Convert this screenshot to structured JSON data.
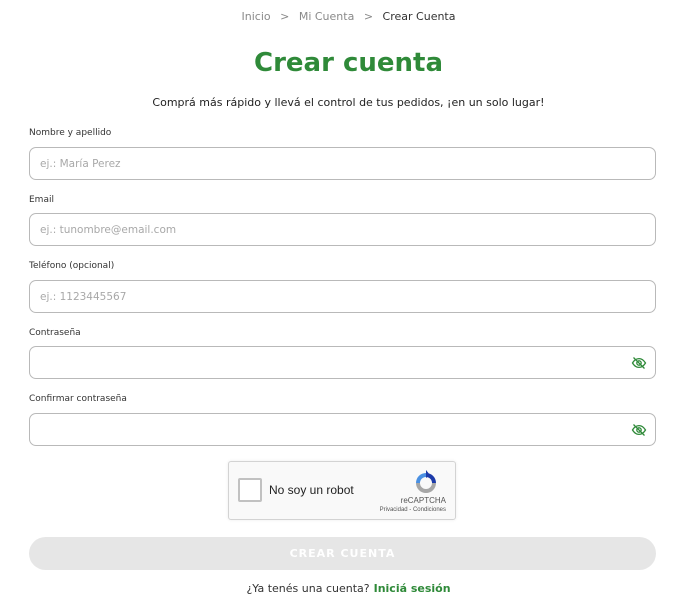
{
  "colors": {
    "accent": "#2f8a39",
    "button_disabled_bg": "#e6e6e6",
    "recaptcha_blue": "#1c3aa9",
    "recaptcha_light_blue": "#4a90e2",
    "recaptcha_gray": "#a6a6a6"
  },
  "breadcrumb": {
    "items": [
      {
        "label": "Inicio"
      },
      {
        "label": "Mi Cuenta"
      }
    ],
    "separator": ">",
    "current": "Crear Cuenta"
  },
  "title": "Crear cuenta",
  "subtitle": "Comprá más rápido y llevá el control de tus pedidos, ¡en un solo lugar!",
  "fields": {
    "name": {
      "label": "Nombre y apellido",
      "placeholder": "ej.: María Perez",
      "value": ""
    },
    "email": {
      "label": "Email",
      "placeholder": "ej.: tunombre@email.com",
      "value": ""
    },
    "phone": {
      "label": "Teléfono (opcional)",
      "placeholder": "ej.: 1123445567",
      "value": ""
    },
    "password": {
      "label": "Contraseña",
      "placeholder": "",
      "value": "",
      "icon": "eye-off-icon"
    },
    "confirm": {
      "label": "Confirmar contraseña",
      "placeholder": "",
      "value": "",
      "icon": "eye-off-icon"
    }
  },
  "captcha": {
    "label": "No soy un robot",
    "brand": "reCAPTCHA",
    "privacy": "Privacidad",
    "terms": "Condiciones",
    "links_separator": "-",
    "icon": "recaptcha-logo-icon"
  },
  "submit": {
    "label": "CREAR CUENTA",
    "state": "disabled"
  },
  "login": {
    "prompt": "¿Ya tenés una cuenta?",
    "link": "Iniciá sesión"
  }
}
